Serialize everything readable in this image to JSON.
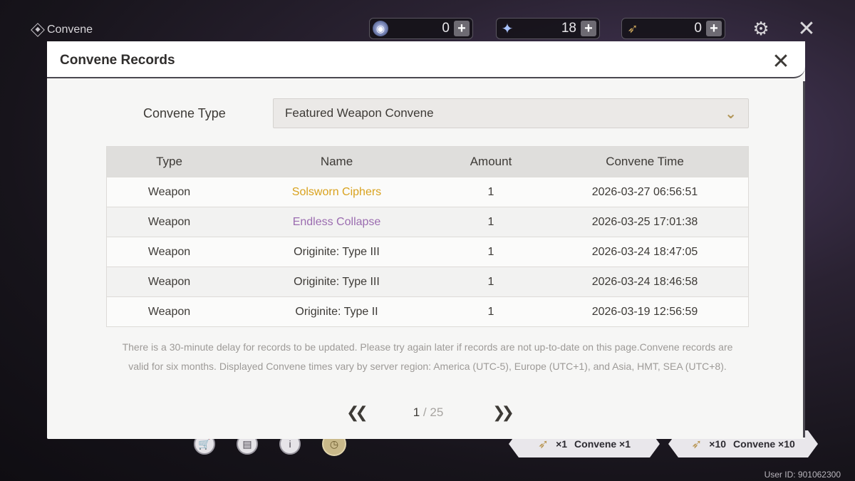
{
  "topbar": {
    "title": "Convene",
    "currencies": [
      {
        "icon": "coin-icon",
        "value": "0"
      },
      {
        "icon": "star-icon",
        "value": "18"
      },
      {
        "icon": "feather-icon",
        "value": "0"
      }
    ]
  },
  "modal": {
    "title": "Convene Records",
    "type_label": "Convene Type",
    "selected_type": "Featured Weapon Convene",
    "columns": [
      "Type",
      "Name",
      "Amount",
      "Convene Time"
    ],
    "rows": [
      {
        "type": "Weapon",
        "name": "Solsworn Ciphers",
        "amount": "1",
        "time": "2026-03-27 06:56:51",
        "rarity_color": "#d9a21e"
      },
      {
        "type": "Weapon",
        "name": "Endless Collapse",
        "amount": "1",
        "time": "2026-03-25 17:01:38",
        "rarity_color": "#9b6cb0"
      },
      {
        "type": "Weapon",
        "name": "Originite: Type III",
        "amount": "1",
        "time": "2026-03-24 18:47:05",
        "rarity_color": "#3d3a36"
      },
      {
        "type": "Weapon",
        "name": "Originite: Type III",
        "amount": "1",
        "time": "2026-03-24 18:46:58",
        "rarity_color": "#3d3a36"
      },
      {
        "type": "Weapon",
        "name": "Originite: Type II",
        "amount": "1",
        "time": "2026-03-19 12:56:59",
        "rarity_color": "#3d3a36"
      }
    ],
    "note": "There is a 30-minute delay for records to be updated. Please try again later if records are not up-to-date on this page.Convene records are valid for six months. Displayed Convene times vary by server region: America (UTC-5), Europe (UTC+1), and Asia, HMT, SEA (UTC+8).",
    "pagination": {
      "current": "1",
      "separator": " / ",
      "total": "25"
    }
  },
  "bottom": {
    "pull_one": {
      "count": "×1",
      "label": "Convene ×1"
    },
    "pull_ten": {
      "count": "×10",
      "label": "Convene ×10"
    },
    "user_id": "User ID: 901062300"
  },
  "colors": {
    "accent_gold": "#b3975a",
    "five_star": "#d9a21e",
    "four_star": "#9b6cb0"
  }
}
